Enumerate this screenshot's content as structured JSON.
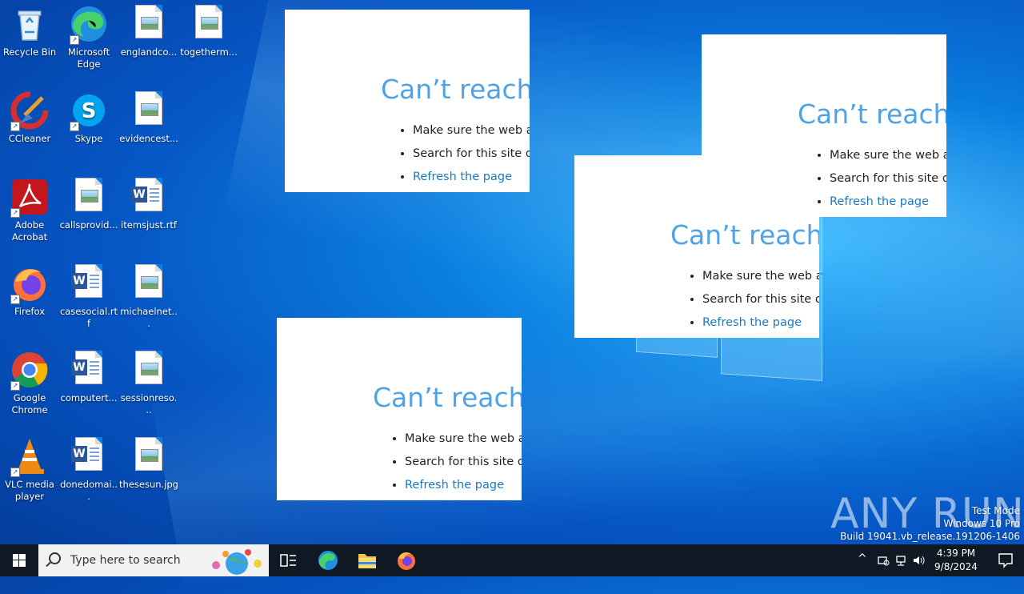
{
  "desktop": {
    "icons": [
      {
        "label": "Recycle Bin"
      },
      {
        "label": "Microsoft Edge"
      },
      {
        "label": "englandco..."
      },
      {
        "label": "togetherm..."
      },
      {
        "label": "CCleaner"
      },
      {
        "label": "Skype"
      },
      {
        "label": "evidencest..."
      },
      {
        "label": "Adobe Acrobat"
      },
      {
        "label": "callsprovid..."
      },
      {
        "label": "itemsjust.rtf"
      },
      {
        "label": "Firefox"
      },
      {
        "label": "casesocial.rtf"
      },
      {
        "label": "michaelnet..."
      },
      {
        "label": "Google Chrome"
      },
      {
        "label": "computert..."
      },
      {
        "label": "sessionreso..."
      },
      {
        "label": "VLC media player"
      },
      {
        "label": "donedomai..."
      },
      {
        "label": "thesesun.jpg"
      }
    ]
  },
  "error_windows": [
    {
      "title": "Can’t reach t",
      "bullet1": "Make sure the web ad",
      "bullet2": "Search for this site on",
      "link": "Refresh the page"
    },
    {
      "title": "Can’t reach t",
      "bullet1": "Make sure the web ad",
      "bullet2": "Search for this site on",
      "link": "Refresh the page"
    },
    {
      "title": "Can’t reach t",
      "bullet1": "Make sure the web ad",
      "bullet2": "Search for this site on",
      "link": "Refresh the page"
    },
    {
      "title": "Can’t reach t",
      "bullet1": "Make sure the web ad",
      "bullet2": "Search for this site on",
      "link": "Refresh the page"
    }
  ],
  "watermark": {
    "brand": "ANY RUN",
    "line1": "Test Mode",
    "line2": "Windows 10 Pro",
    "line3": "Build 19041.vb_release.191206-1406"
  },
  "taskbar": {
    "search_placeholder": "Type here to search",
    "time": "4:39 PM",
    "date": "9/8/2024"
  },
  "colors": {
    "accent": "#0a7fe0",
    "error_title": "#4ea3e6",
    "link": "#1a78c2",
    "taskbar": "#101923"
  }
}
